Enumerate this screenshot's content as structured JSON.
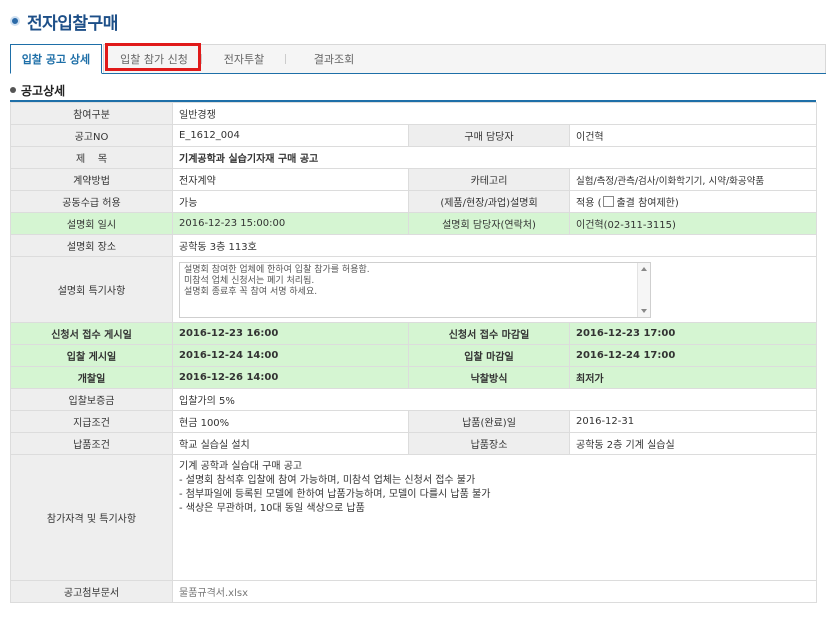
{
  "page": {
    "title": "전자입찰구매"
  },
  "tabs": [
    "입찰 공고 상세",
    "입찰 참가 신청",
    "전자투찰",
    "결과조회"
  ],
  "section": {
    "title": "공고상세"
  },
  "fields": {
    "category": {
      "label": "참여구분",
      "value": "일반경쟁"
    },
    "notice_no": {
      "label": "공고NO",
      "value": "E_1612_004"
    },
    "manager": {
      "label": "구매 담당자",
      "value": "이건혁"
    },
    "subject": {
      "label": "제    목",
      "value": "기계공학과 실습기자재 구매 공고"
    },
    "contract_method": {
      "label": "계약방법",
      "value": "전자계약"
    },
    "category_type": {
      "label": "카테고리",
      "value": "실험/측정/관측/검사/이화학기기, 시약/화공약품"
    },
    "joint_supply": {
      "label": "공동수급 허용",
      "value": "가능"
    },
    "briefing": {
      "label": "(제품/현장/과업)설명회",
      "value_prefix": "적용 (",
      "value_suffix": "출결 참여제한)"
    },
    "briefing_datetime": {
      "label": "설명회 일시",
      "value": "2016-12-23 15:00:00"
    },
    "briefing_contact": {
      "label": "설명회 담당자(연락처)",
      "value": "이건혁(02-311-3115)"
    },
    "briefing_place": {
      "label": "설명회 장소",
      "value": "공학동 3층 113호"
    },
    "briefing_notes": {
      "label": "설명회 특기사항",
      "value": "설명회 참여한 업체에 한하여 입찰 참가를 허용함.\n미참석 업체 신청서는 폐기 처리됨.\n설명회 종료후 꼭 참여 서명 하세요."
    },
    "app_start": {
      "label": "신청서 접수 게시일",
      "value": "2016-12-23 16:00"
    },
    "app_end": {
      "label": "신청서 접수 마감일",
      "value": "2016-12-23 17:00"
    },
    "bid_start": {
      "label": "입찰 게시일",
      "value": "2016-12-24 14:00"
    },
    "bid_end": {
      "label": "입찰 마감일",
      "value": "2016-12-24 17:00"
    },
    "opening": {
      "label": "개찰일",
      "value": "2016-12-26 14:00"
    },
    "award_method": {
      "label": "낙찰방식",
      "value": "최저가"
    },
    "bid_bond": {
      "label": "입찰보증금",
      "value": "입찰가의 5%"
    },
    "payment": {
      "label": "지급조건",
      "value": "현금 100%"
    },
    "delivery_date": {
      "label": "납품(완료)일",
      "value": "2016-12-31"
    },
    "delivery_cond": {
      "label": "납품조건",
      "value": "학교 실습실 설치"
    },
    "delivery_place": {
      "label": "납품장소",
      "value": "공학동 2층 기계 실습실"
    },
    "qualification": {
      "label": "참가자격 및 특기사항",
      "value": "기계 공학과 실습대 구매 공고\n- 설명회 참석후 입찰에 참여 가능하며, 미참석 업체는 신청서 접수 불가\n- 첨부파일에 등록된 모델에 한하여 납품가능하며, 모델이 다를시 납품 불가\n- 색상은 무관하며, 10대 동일 색상으로 납품"
    },
    "attachment": {
      "label": "공고첨부문서",
      "value": "물품규격서.xlsx"
    }
  },
  "colors": {
    "accent": "#1e6fa8",
    "highlight_row": "#d5f5d2",
    "annotation_box": "#e01a1a"
  }
}
